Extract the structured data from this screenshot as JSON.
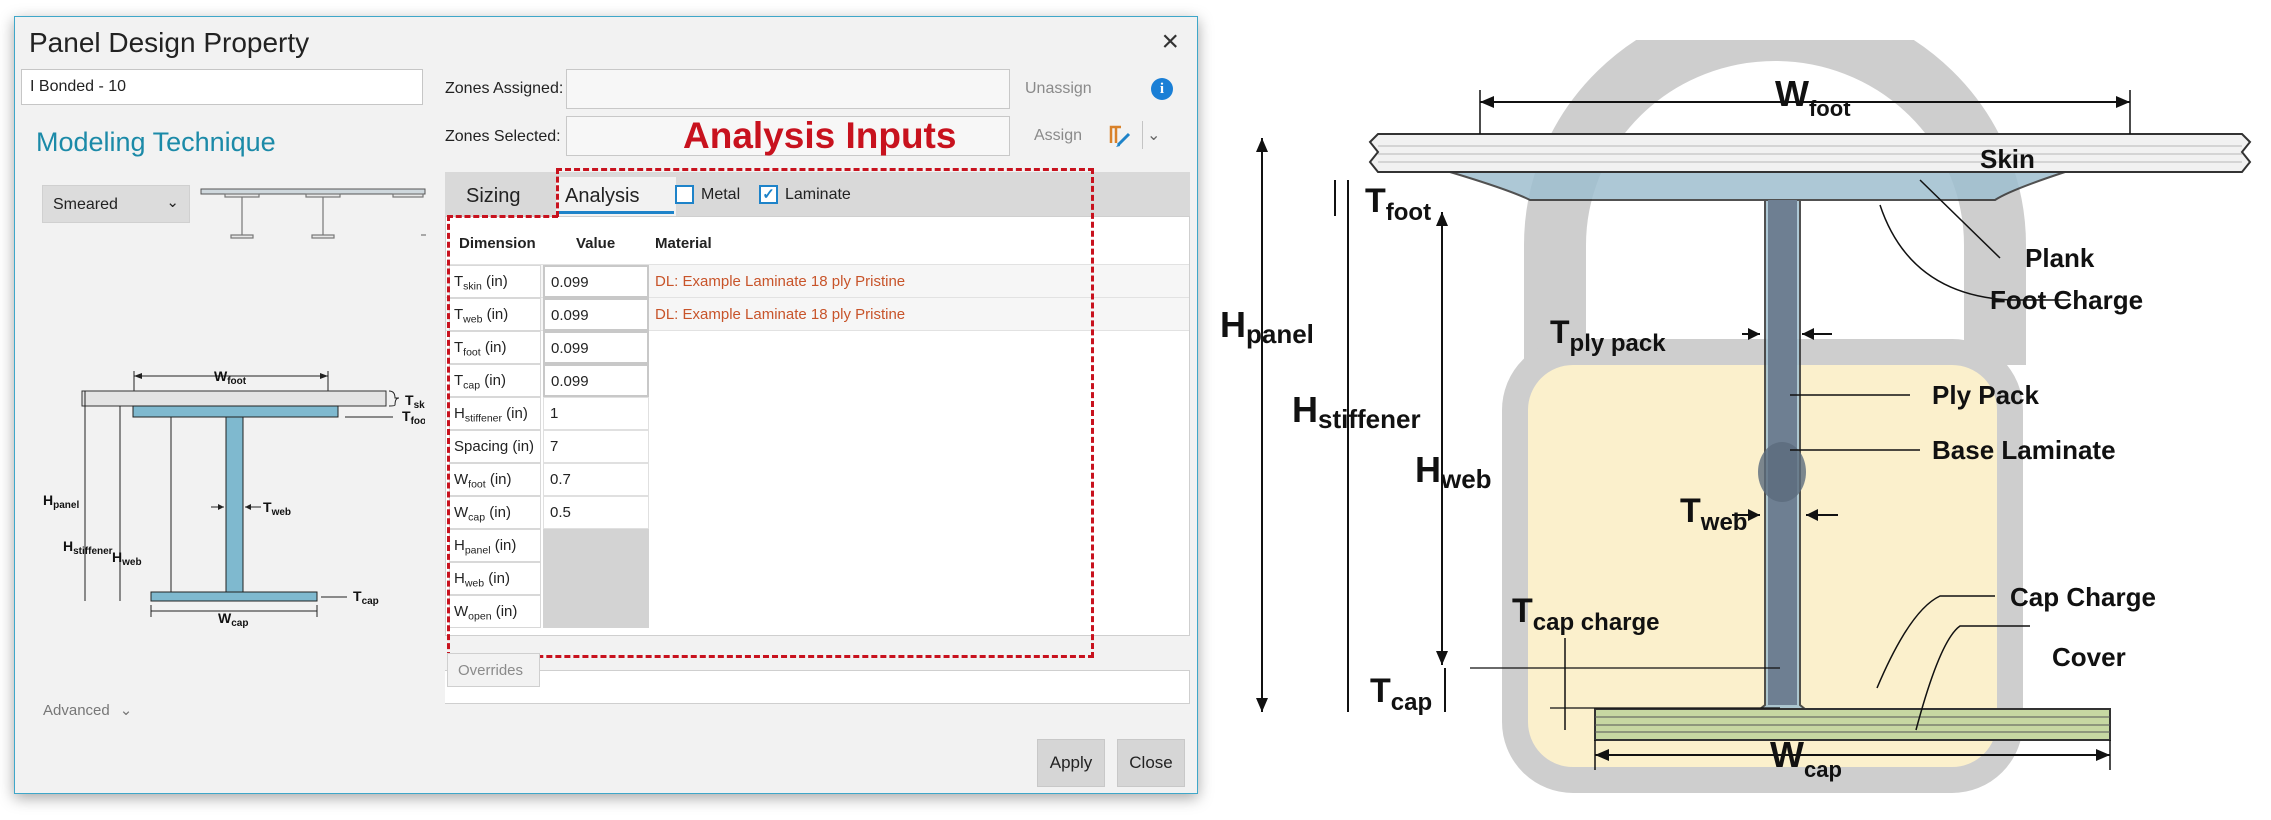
{
  "dialog": {
    "title": "Panel Design Property",
    "name_value": "I Bonded - 10",
    "zones_assigned_label": "Zones Assigned:",
    "zones_selected_label": "Zones Selected:",
    "unassign_label": "Unassign",
    "assign_label": "Assign",
    "info_icon": "i",
    "modeling_heading": "Modeling Technique",
    "modeling_value": "Smeared",
    "annotation": "Analysis Inputs",
    "tabs": [
      {
        "label": "Sizing"
      },
      {
        "label": "Analysis"
      }
    ],
    "checkboxes": [
      {
        "label": "Metal",
        "checked": false
      },
      {
        "label": "Laminate",
        "checked": true
      }
    ],
    "table": {
      "headers": [
        "Dimension",
        "Value",
        "Material"
      ],
      "rows": [
        {
          "sym": "T",
          "sub": "skin",
          "unit": " (in)",
          "value": "0.099",
          "material": "DL: Example Laminate 18 ply Pristine"
        },
        {
          "sym": "T",
          "sub": "web",
          "unit": " (in)",
          "value": "0.099",
          "material": "DL: Example Laminate 18 ply Pristine"
        },
        {
          "sym": "T",
          "sub": "foot",
          "unit": " (in)",
          "value": "0.099",
          "material": ""
        },
        {
          "sym": "T",
          "sub": "cap",
          "unit": " (in)",
          "value": "0.099",
          "material": ""
        },
        {
          "sym": "H",
          "sub": "stiffener",
          "unit": " (in)",
          "value": "1",
          "material": ""
        },
        {
          "sym": "Spacing",
          "sub": "",
          "unit": " (in)",
          "value": "7",
          "material": ""
        },
        {
          "sym": "W",
          "sub": "foot",
          "unit": " (in)",
          "value": "0.7",
          "material": ""
        },
        {
          "sym": "W",
          "sub": "cap",
          "unit": " (in)",
          "value": "0.5",
          "material": ""
        },
        {
          "sym": "H",
          "sub": "panel",
          "unit": " (in)",
          "value": "",
          "material": ""
        },
        {
          "sym": "H",
          "sub": "web",
          "unit": " (in)",
          "value": "",
          "material": ""
        },
        {
          "sym": "W",
          "sub": "open",
          "unit": " (in)",
          "value": "",
          "material": ""
        }
      ]
    },
    "overrides_label": "Overrides",
    "advanced_label": "Advanced",
    "apply_label": "Apply",
    "close_label": "Close"
  },
  "mini_diagram": {
    "w_foot": {
      "sym": "W",
      "sub": "foot"
    },
    "t_skin": {
      "sym": "T",
      "sub": "skin"
    },
    "t_foot": {
      "sym": "T",
      "sub": "foot"
    },
    "h_panel": {
      "sym": "H",
      "sub": "panel"
    },
    "h_stiffener": {
      "sym": "H",
      "sub": "stiffener"
    },
    "h_web": {
      "sym": "H",
      "sub": "web"
    },
    "t_web": {
      "sym": "T",
      "sub": "web"
    },
    "t_cap": {
      "sym": "T",
      "sub": "cap"
    },
    "w_cap": {
      "sym": "W",
      "sub": "cap"
    }
  },
  "big_diagram": {
    "w_foot": {
      "sym": "W",
      "sub": "foot"
    },
    "skin": "Skin",
    "t_foot": {
      "sym": "T",
      "sub": "foot"
    },
    "plank": "Plank",
    "foot_charge": "Foot Charge",
    "h_panel": {
      "sym": "H",
      "sub": "panel"
    },
    "t_ply_pack": {
      "sym": "T",
      "sub": "ply pack"
    },
    "ply_pack": "Ply Pack",
    "h_stiffener": {
      "sym": "H",
      "sub": "stiffener"
    },
    "base_laminate": "Base Laminate",
    "h_web": {
      "sym": "H",
      "sub": "web"
    },
    "t_web": {
      "sym": "T",
      "sub": "web"
    },
    "cap_charge": "Cap Charge",
    "t_cap_charge": {
      "sym": "T",
      "sub": "cap charge"
    },
    "cover": "Cover",
    "t_cap": {
      "sym": "T",
      "sub": "cap"
    },
    "w_cap": {
      "sym": "W",
      "sub": "cap"
    }
  },
  "colors": {
    "accent": "#1e83c9",
    "heading": "#1b8aa8",
    "annotation_red": "#c8121e",
    "material_orange": "#c8542a",
    "stiffener_blue": "#7fb9cf"
  }
}
